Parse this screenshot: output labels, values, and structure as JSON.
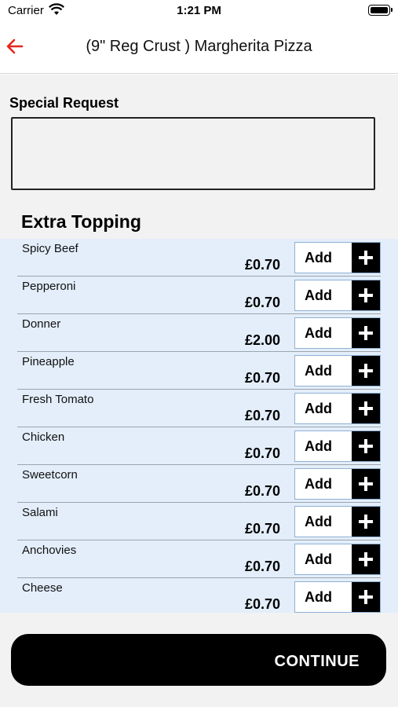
{
  "status_bar": {
    "carrier": "Carrier",
    "time": "1:21 PM"
  },
  "nav": {
    "title": "(9\" Reg Crust ) Margherita Pizza",
    "back_icon": "arrow-left-icon",
    "accent": "#e8261c"
  },
  "special_request": {
    "label": "Special Request",
    "value": "",
    "placeholder": ""
  },
  "extra_topping": {
    "title": "Extra Topping",
    "add_label": "Add",
    "items": [
      {
        "name": "Spicy Beef",
        "price": "£0.70"
      },
      {
        "name": "Pepperoni",
        "price": "£0.70"
      },
      {
        "name": "Donner",
        "price": "£2.00"
      },
      {
        "name": "Pineapple",
        "price": "£0.70"
      },
      {
        "name": "Fresh Tomato",
        "price": "£0.70"
      },
      {
        "name": "Chicken",
        "price": "£0.70"
      },
      {
        "name": "Sweetcorn",
        "price": "£0.70"
      },
      {
        "name": "Salami",
        "price": "£0.70"
      },
      {
        "name": "Anchovies",
        "price": "£0.70"
      },
      {
        "name": "Cheese",
        "price": "£0.70"
      }
    ]
  },
  "continue_label": "CONTINUE"
}
